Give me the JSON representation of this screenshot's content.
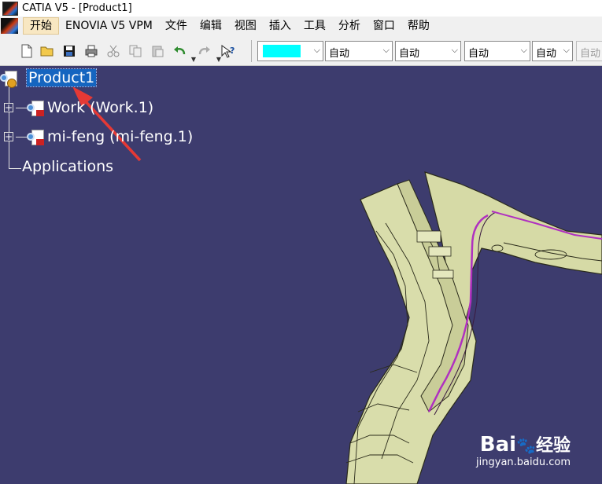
{
  "window": {
    "title": "CATIA V5 - [Product1]"
  },
  "menu": {
    "items": [
      "开始",
      "ENOVIA V5 VPM",
      "文件",
      "编辑",
      "视图",
      "插入",
      "工具",
      "分析",
      "窗口",
      "帮助"
    ]
  },
  "toolbar": {
    "icons": [
      "new-icon",
      "open-icon",
      "save-icon",
      "print-icon",
      "cut-icon",
      "copy-icon",
      "paste-icon",
      "undo-icon",
      "redo-icon",
      "whats-this-icon"
    ],
    "color_swatch": "#00ffff",
    "combos": [
      "自动",
      "自动",
      "自动",
      "自动",
      "自动"
    ]
  },
  "tree": {
    "root": "Product1",
    "children": [
      "Work (Work.1)",
      "mi-feng (mi-feng.1)"
    ],
    "applications": "Applications"
  },
  "colors": {
    "viewport_bg": "#3d3c6e",
    "part_fill": "#d8dcaa",
    "selection": "#1565c0",
    "annotation_arrow": "#e53935"
  },
  "watermark": {
    "brand": "Bai",
    "brand2": "经验",
    "url": "jingyan.baidu.com"
  }
}
